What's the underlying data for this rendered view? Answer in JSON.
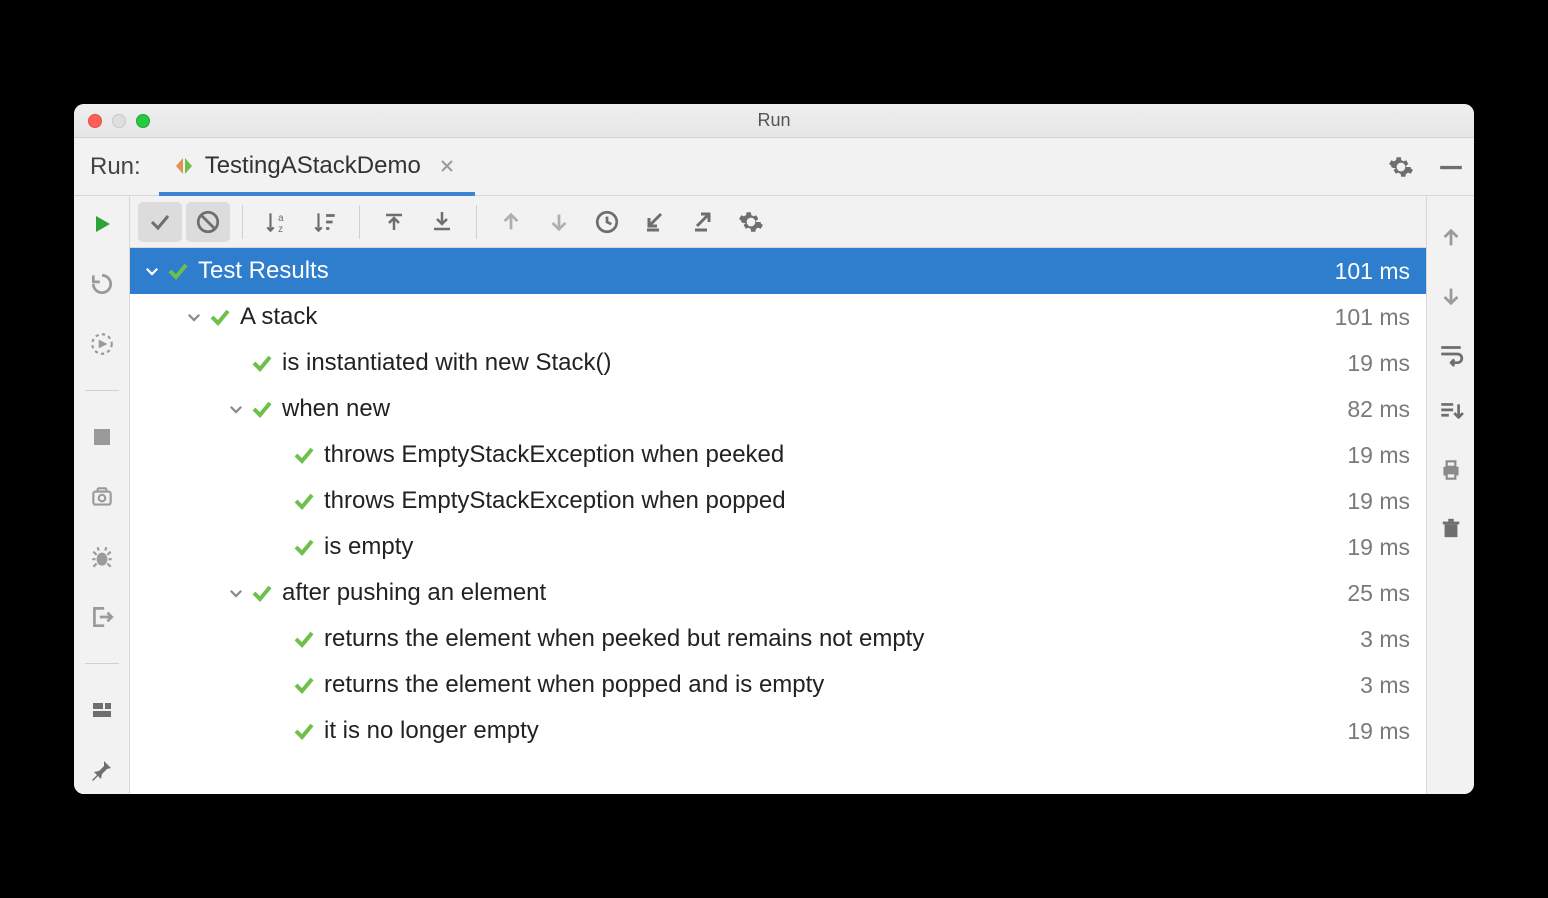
{
  "window": {
    "title": "Run"
  },
  "panel": {
    "label": "Run:"
  },
  "tab": {
    "name": "TestingAStackDemo"
  },
  "results": {
    "root": {
      "label": "Test Results",
      "time": "101 ms"
    },
    "nodes": [
      {
        "indent": 1,
        "expand": true,
        "label": "A stack",
        "time": "101 ms"
      },
      {
        "indent": 2,
        "expand": false,
        "label": "is instantiated with new Stack()",
        "time": "19 ms"
      },
      {
        "indent": 2,
        "expand": true,
        "label": "when new",
        "time": "82 ms"
      },
      {
        "indent": 3,
        "expand": false,
        "label": "throws EmptyStackException when peeked",
        "time": "19 ms"
      },
      {
        "indent": 3,
        "expand": false,
        "label": "throws EmptyStackException when popped",
        "time": "19 ms"
      },
      {
        "indent": 3,
        "expand": false,
        "label": "is empty",
        "time": "19 ms"
      },
      {
        "indent": 2,
        "expand": true,
        "label": "after pushing an element",
        "time": "25 ms"
      },
      {
        "indent": 3,
        "expand": false,
        "label": "returns the element when peeked but remains not empty",
        "time": "3 ms"
      },
      {
        "indent": 3,
        "expand": false,
        "label": "returns the element when popped and is empty",
        "time": "3 ms"
      },
      {
        "indent": 3,
        "expand": false,
        "label": "it is no longer empty",
        "time": "19 ms"
      }
    ]
  }
}
